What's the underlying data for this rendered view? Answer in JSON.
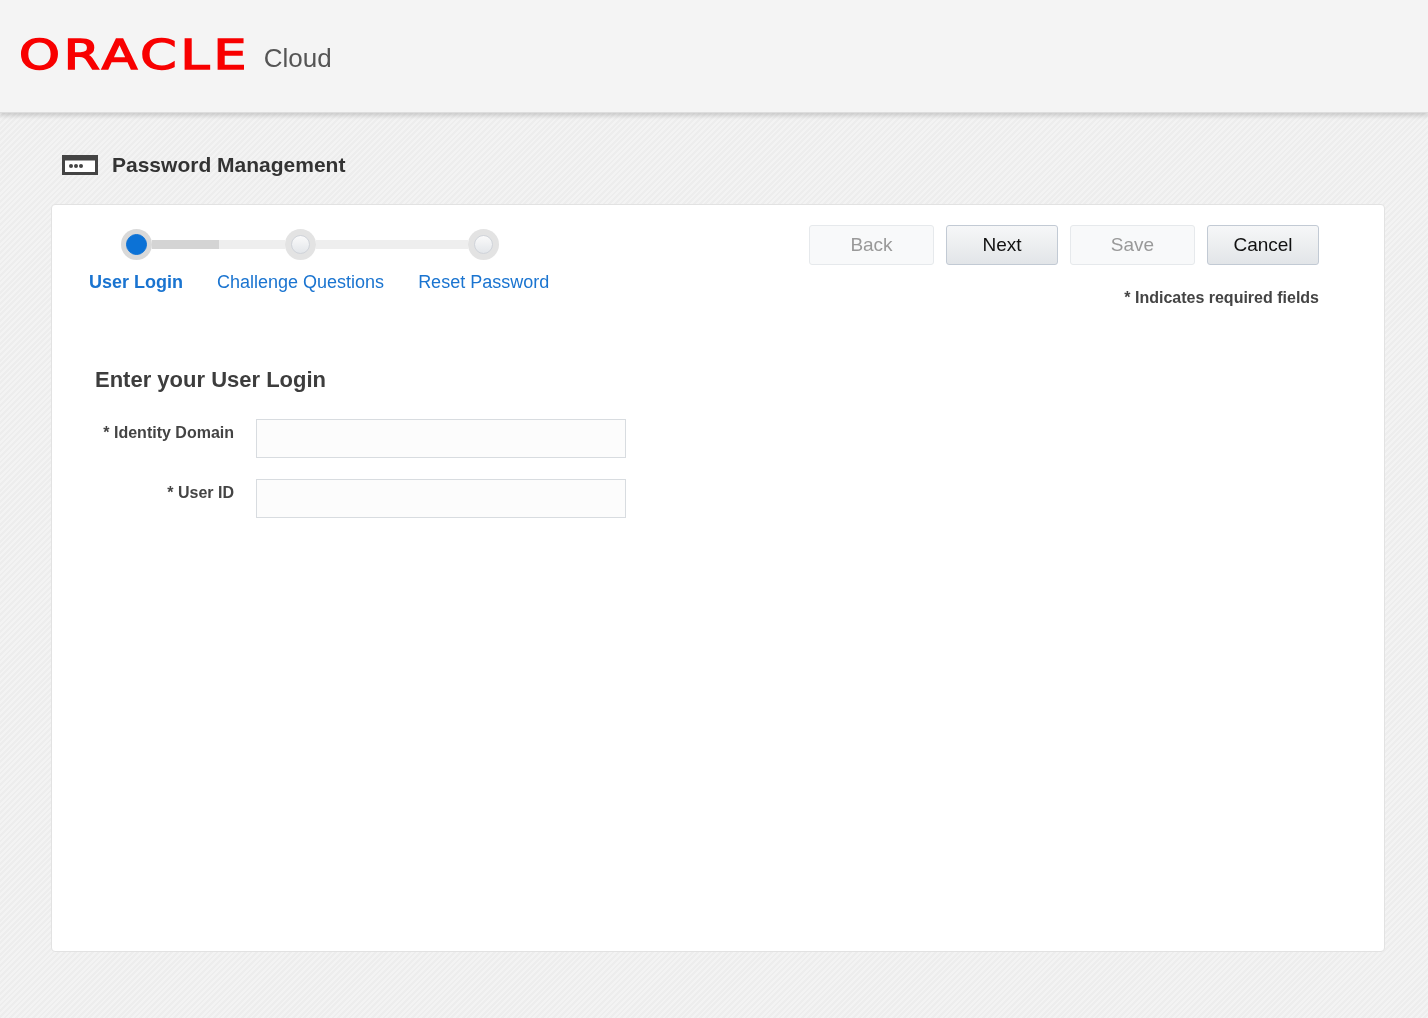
{
  "header": {
    "brand": "ORACLE",
    "product": "Cloud"
  },
  "page_title": "Password Management",
  "train": [
    {
      "label": "User Login",
      "selected": true
    },
    {
      "label": "Challenge Questions",
      "selected": false
    },
    {
      "label": "Reset Password",
      "selected": false
    }
  ],
  "buttons": [
    {
      "label": "Back",
      "disabled": true
    },
    {
      "label": "Next",
      "disabled": false
    },
    {
      "label": "Save",
      "disabled": true
    },
    {
      "label": "Cancel",
      "disabled": false
    }
  ],
  "required_note": "* Indicates required fields",
  "form": {
    "heading": "Enter your User Login",
    "fields": [
      {
        "label": "* Identity Domain"
      },
      {
        "label": "* User ID"
      }
    ]
  }
}
